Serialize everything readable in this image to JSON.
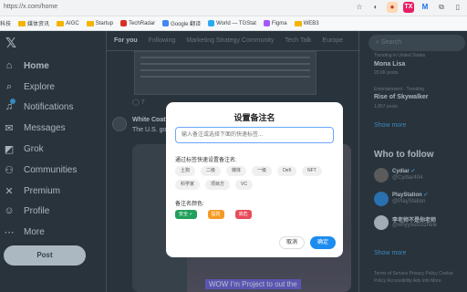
{
  "browser": {
    "url": "https://x.com/home",
    "extensions": [
      "profile-icon",
      "extension-orange-icon",
      "tx-extension-icon",
      "m-extension-icon",
      "puzzle-icon",
      "sidebar-icon"
    ],
    "bookmarks": [
      "科技",
      "媒体资讯",
      "AIGC",
      "Startup",
      "TechRadar",
      "Google 翻译",
      "World — TGStat",
      "Figma",
      "WEB3"
    ]
  },
  "sidebar": {
    "items": [
      {
        "label": "Home",
        "icon": "home-icon"
      },
      {
        "label": "Explore",
        "icon": "search-icon"
      },
      {
        "label": "Notifications",
        "icon": "bell-icon"
      },
      {
        "label": "Messages",
        "icon": "mail-icon"
      },
      {
        "label": "Grok",
        "icon": "grok-icon"
      },
      {
        "label": "Communities",
        "icon": "people-icon"
      },
      {
        "label": "Premium",
        "icon": "x-icon"
      },
      {
        "label": "Profile",
        "icon": "person-icon"
      },
      {
        "label": "More",
        "icon": "more-icon"
      }
    ],
    "post_label": "Post"
  },
  "feed": {
    "tabs": [
      "For you",
      "Following",
      "Marketing Strategy Community",
      "Tech Talk",
      "Europe"
    ],
    "reply_count": "7",
    "tweet_name": "White Coat",
    "tweet_text": "The U.S. go... Russian lab...",
    "media_caption": "WOW I'm Project to out the"
  },
  "right": {
    "search_placeholder": "Search",
    "trends": [
      {
        "context": "Trending in United States",
        "name": "Mona Lisa",
        "count": "20.6K posts"
      },
      {
        "context": "Entertainment · Trending",
        "name": "Rise of Skywalker",
        "count": "1,857 posts"
      }
    ],
    "show_more": "Show more",
    "who_to_follow": "Who to follow",
    "follows": [
      {
        "name": "Cydiar",
        "handle": "@Cydiar404"
      },
      {
        "name": "PlayStation",
        "handle": "@PlayStation"
      },
      {
        "name": "李老师不是你老师",
        "handle": "@whyyoutouzhele"
      }
    ],
    "show_more_2": "Show more",
    "footer": "Terms of Service  Privacy Policy  Cookie Policy  Accessibility  Ads info  More"
  },
  "modal": {
    "title": "设置备注名",
    "input_placeholder": "输入备注或选择下面的快速标签...",
    "quick_label": "通过标签快速设置备注名:",
    "tags": [
      "土狗",
      "二级",
      "媒体",
      "一级",
      "Defi",
      "NFT",
      "科学家",
      "项目方",
      "VC"
    ],
    "color_label": "备注名颜色:",
    "colors": [
      {
        "label": "安全 ✓",
        "color": "#21a05b"
      },
      {
        "label": "提防",
        "color": "#f59a23"
      },
      {
        "label": "高危",
        "color": "#e84c5a"
      }
    ],
    "cancel_label": "取消",
    "confirm_label": "确定"
  }
}
